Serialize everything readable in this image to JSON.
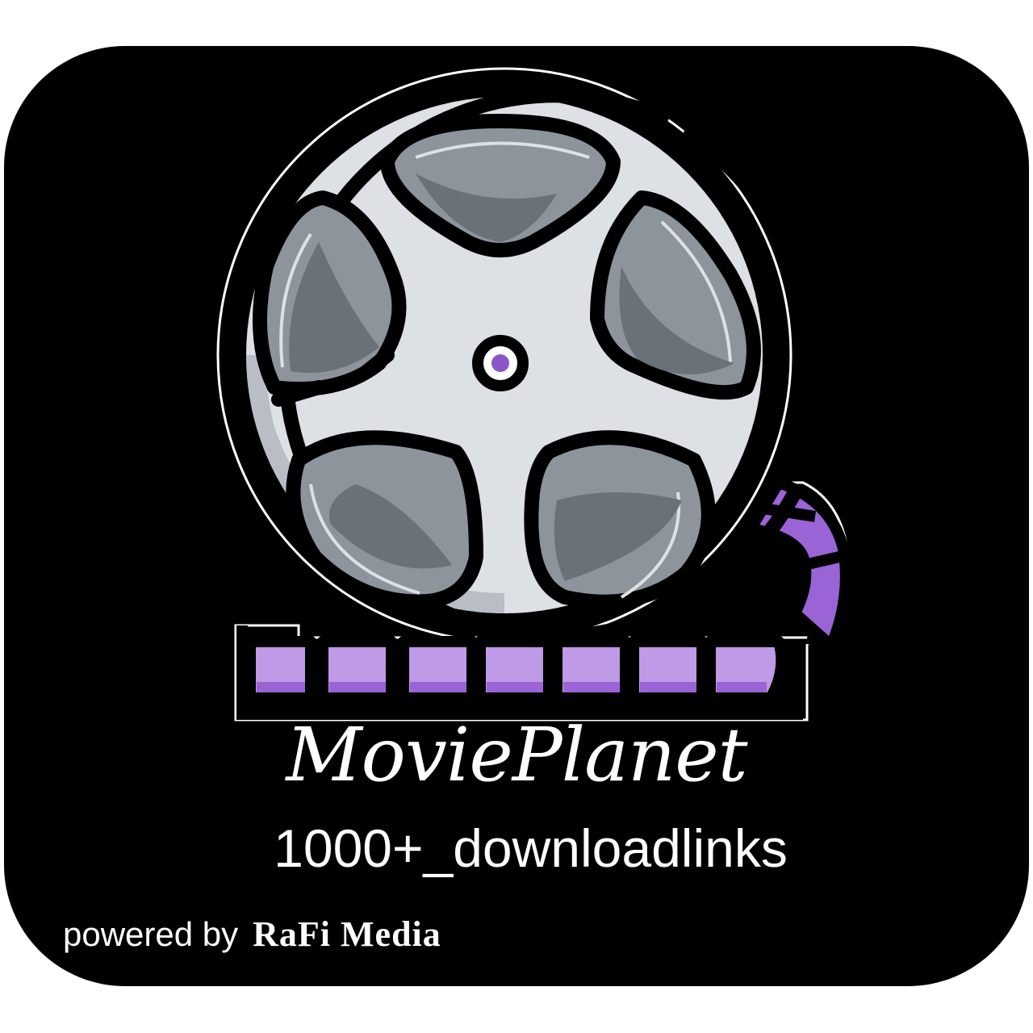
{
  "brand": {
    "title": "MoviePlanet",
    "subtitle": "1000+_downloadlinks"
  },
  "footer": {
    "powered_by": "powered by",
    "company": "RaFi Media"
  },
  "logo": {
    "icon": "film-reel-icon",
    "colors": {
      "background": "#000000",
      "reel_face": "#dde1e6",
      "reel_shadow": "#b9bec6",
      "window_fill": "#8d949c",
      "window_shadow": "#6b7178",
      "film_light": "#bf9ae6",
      "film_dark": "#9a63d6",
      "hub": "#8a55c6"
    }
  }
}
